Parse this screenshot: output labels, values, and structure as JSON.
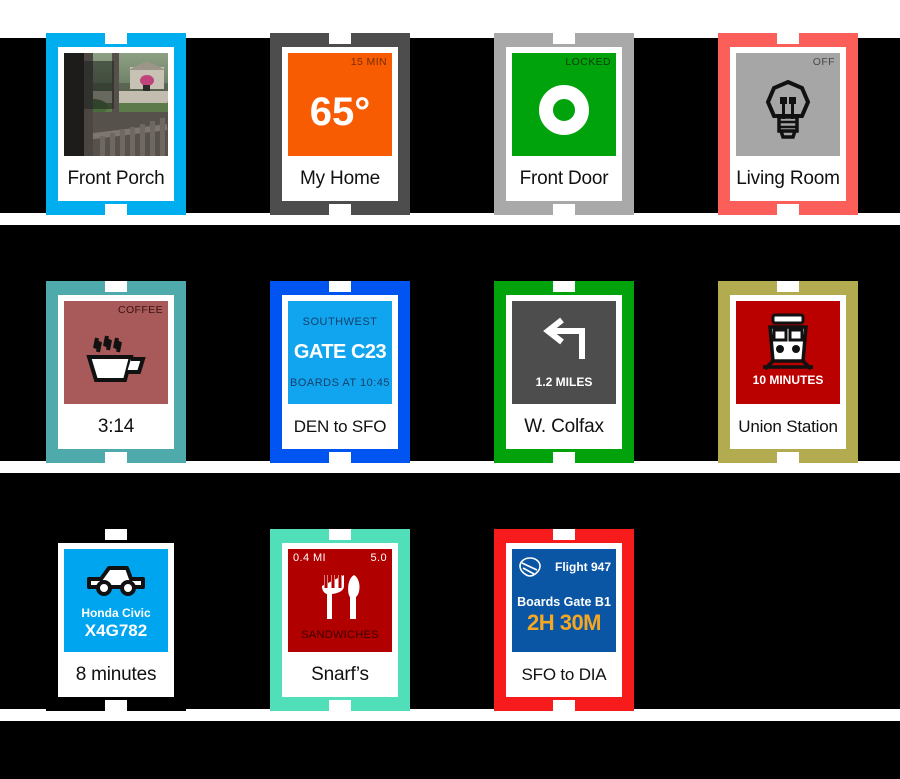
{
  "page": {
    "background": "#000000",
    "separator_color": "#ffffff"
  },
  "rows": [
    {
      "cards": [
        {
          "name": "front-porch",
          "border_color": "#00aeef",
          "panel_color": "#5c6652",
          "kind": "camera",
          "corner_right": "",
          "caption": "Front Porch"
        },
        {
          "name": "my-home-thermostat",
          "border_color": "#4d4d4d",
          "panel_color": "#f75c03",
          "kind": "thermostat",
          "corner_right": "15 MIN",
          "value": "65°",
          "caption": "My Home"
        },
        {
          "name": "front-door-lock",
          "border_color": "#a9a9a9",
          "panel_color": "#00a30b",
          "kind": "lock",
          "corner_right": "LOCKED",
          "caption": "Front Door"
        },
        {
          "name": "living-room-light",
          "border_color": "#fc5f5a",
          "panel_color": "#a6a6a6",
          "kind": "bulb",
          "corner_right": "OFF",
          "caption": "Living Room"
        }
      ]
    },
    {
      "cards": [
        {
          "name": "coffee-timer",
          "border_color": "#4fabab",
          "panel_color": "#a85a5a",
          "kind": "coffee",
          "corner_right": "COFFEE",
          "caption": "3:14"
        },
        {
          "name": "southwest-boarding-pass",
          "border_color": "#0055f0",
          "panel_color": "#12a5ef",
          "kind": "gate",
          "airline": "SOUTHWEST",
          "gate": "GATE C23",
          "boards": "BOARDS AT 10:45",
          "caption": "DEN to SFO"
        },
        {
          "name": "navigation-turn",
          "border_color": "#00a30b",
          "panel_color": "#4d4d4d",
          "kind": "turn",
          "distance": "1.2 MILES",
          "caption": "W. Colfax"
        },
        {
          "name": "union-station-train",
          "border_color": "#b2ab50",
          "panel_color": "#bb0000",
          "kind": "train",
          "eta": "10 MINUTES",
          "caption": "Union Station"
        }
      ]
    },
    {
      "cards": [
        {
          "name": "rideshare-car",
          "border_color": "#000000",
          "panel_color": "#00a5f0",
          "kind": "car",
          "car_model": "Honda Civic",
          "plate": "X4G782",
          "caption": "8 minutes"
        },
        {
          "name": "snarfs-restaurant",
          "border_color": "#51dfba",
          "panel_color": "#b00000",
          "kind": "restaurant",
          "corner_left": "0.4 MI",
          "corner_right": "5.0",
          "cuisine": "SANDWICHES",
          "caption": "Snarf’s"
        },
        {
          "name": "united-flight",
          "border_color": "#f71b1b",
          "panel_color": "#0b56a4",
          "kind": "flight",
          "flight_number": "Flight 947",
          "gate_line": "Boards Gate B1",
          "duration": "2H 30M",
          "caption": "SFO to DIA"
        }
      ]
    }
  ]
}
